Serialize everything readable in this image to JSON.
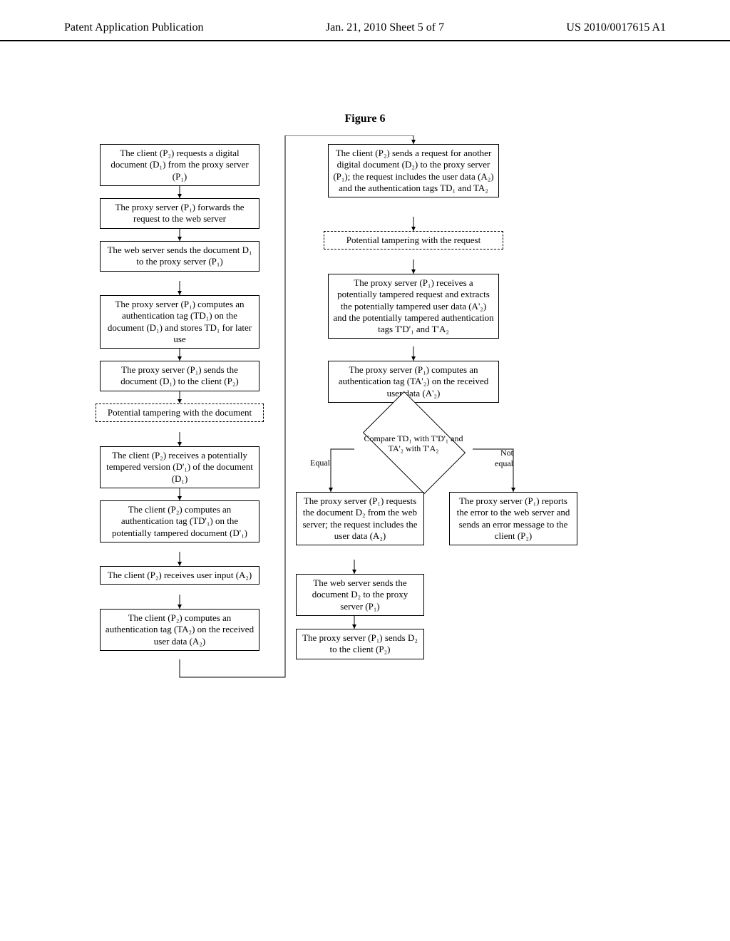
{
  "header": {
    "left": "Patent Application Publication",
    "center": "Jan. 21, 2010  Sheet 5 of 7",
    "right": "US 2010/0017615 A1"
  },
  "figure_title": "Figure 6",
  "boxes": {
    "b1": "The client (P₂) requests a digital document (D₁) from the proxy server (P₁)",
    "b2": "The proxy server (P₁) forwards the request to the web server",
    "b3": "The web server sends the document D₁ to the proxy server (P₁)",
    "b4": "The proxy server (P₁) computes an authentication tag (TD₁) on the document (D₁) and stores TD₁ for later use",
    "b5": "The proxy server (P₁) sends the document (D₁) to the client (P₂)",
    "b6": "Potential tampering with the document",
    "b7": "The client (P₂) receives a potentially tempered version (D'₁) of the document (D₁)",
    "b8": "The client (P₂) computes an authentication tag (TD'₁) on the potentially tampered document (D'₁)",
    "b9": "The client (P₂) receives user input (A₂)",
    "b10": "The client (P₂) computes an authentication tag (TA₂) on the received user data (A₂)",
    "r1": "The client (P₂) sends a request for another digital document (D₂) to the proxy server (P₁); the request includes the user data (A₂) and the authentication tags TD₁ and TA₂",
    "r2": "Potential tampering with the request",
    "r3": "The proxy server (P₁) receives a potentially tampered request and extracts the potentially tampered user data (A'₂) and the potentially tampered authentication tags T'D'₁ and T'A₂",
    "r4": "The proxy server (P₁) computes an authentication tag (TA'₂) on the received user data (A'₂)",
    "r5": "Compare TD₁ with T'D'₁ and TA'₂ with T'A₂",
    "r6": "The proxy server (P₁) requests the document D₂ from the web server; the request includes the user data (A₂)",
    "r7": "The proxy server (P₁) reports the error to the web server and sends an error message to the client (P₂)",
    "r8": "The web server sends the document D₂ to the proxy server (P₁)",
    "r9": "The proxy server (P₁) sends D₂ to the client (P₂)"
  },
  "labels": {
    "equal": "Equal",
    "notequal": "Not equal"
  }
}
